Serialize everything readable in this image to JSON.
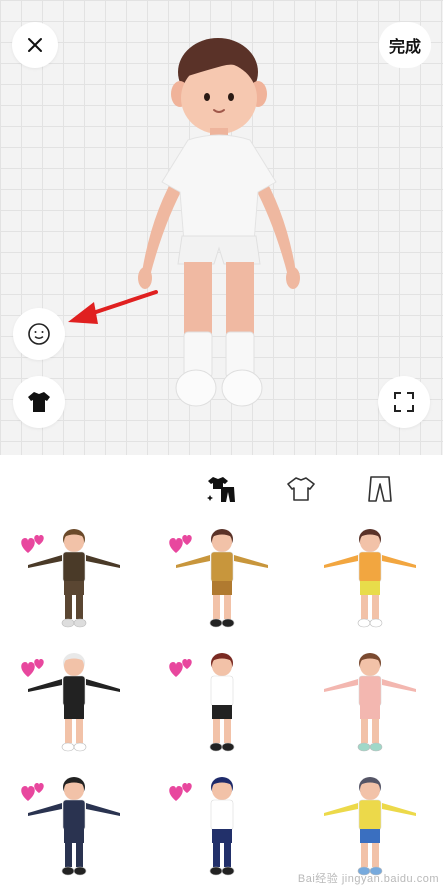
{
  "header": {
    "close_icon": "close-icon",
    "done_label": "完成"
  },
  "side_buttons": {
    "face_icon": "face-icon",
    "outfit_icon": "tshirt-icon",
    "fullscreen_icon": "fullscreen-icon"
  },
  "tabs": [
    {
      "name": "outfit-set-icon",
      "selected": true
    },
    {
      "name": "top-icon",
      "selected": false
    },
    {
      "name": "pants-icon",
      "selected": false
    }
  ],
  "outfits": [
    {
      "id": 1,
      "favorite": true
    },
    {
      "id": 2,
      "favorite": true
    },
    {
      "id": 3,
      "favorite": false
    },
    {
      "id": 4,
      "favorite": true
    },
    {
      "id": 5,
      "favorite": true
    },
    {
      "id": 6,
      "favorite": false
    },
    {
      "id": 7,
      "favorite": true
    },
    {
      "id": 8,
      "favorite": true
    },
    {
      "id": 9,
      "favorite": false
    }
  ],
  "colors": {
    "heart": "#e8479e",
    "arrow": "#e02020"
  },
  "watermark": "Bai经验 jingyan.baidu.com"
}
